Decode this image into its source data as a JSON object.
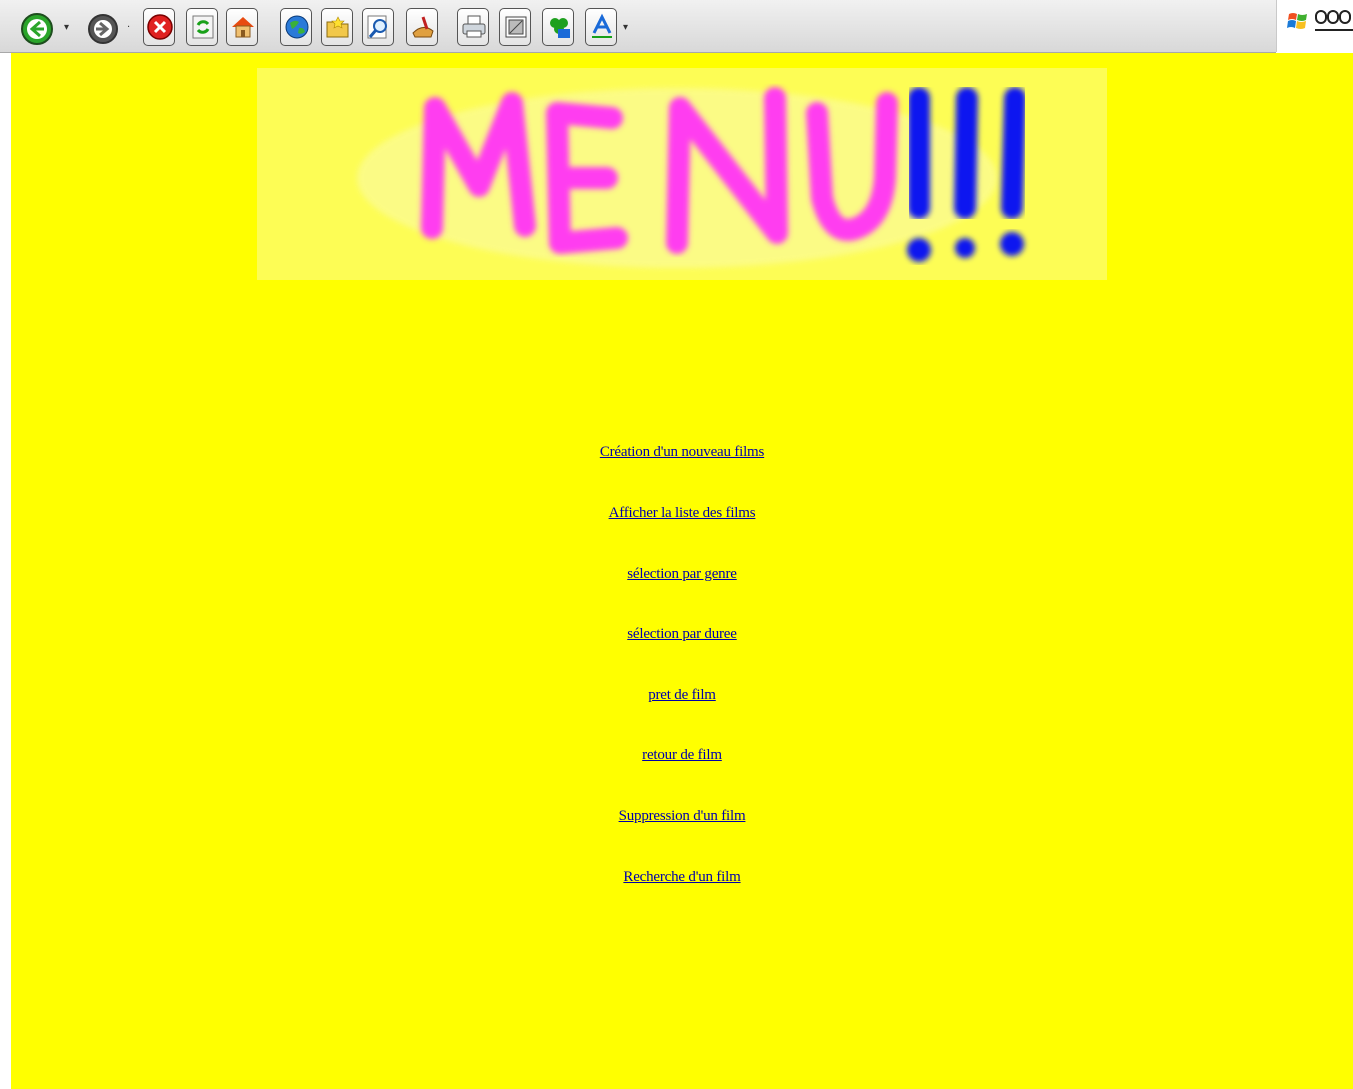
{
  "toolbar": {
    "buttons": [
      "back-icon",
      "forward-icon",
      "stop-icon",
      "refresh-icon",
      "home-icon",
      "globe-icon",
      "open-folder-icon",
      "search-icon",
      "favorites-icon",
      "print-icon",
      "page-setup-icon",
      "addon-icon",
      "font-icon"
    ]
  },
  "banner": {
    "text_main": "MENU",
    "text_bang": "!!!",
    "color_main": "#ff3df0",
    "color_bang": "#0a14f0"
  },
  "menu": {
    "items": [
      "Création d'un nouveau films",
      "Afficher la liste des films",
      "sélection par genre",
      "sélection par duree",
      "pret de film",
      "retour de film",
      "Suppression d'un film",
      "Recherche d'un film"
    ]
  },
  "colors": {
    "page_background": "#ffff00",
    "link": "#0000aa"
  }
}
